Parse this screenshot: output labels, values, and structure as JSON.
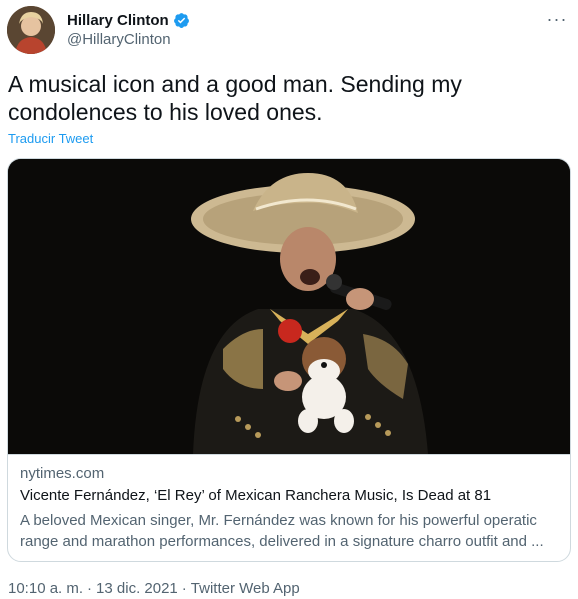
{
  "author": {
    "name": "Hillary Clinton",
    "handle": "@HillaryClinton",
    "verified_icon": "verified-badge-icon",
    "avatar_icon": "profile-avatar"
  },
  "more_icon": "more-options-icon",
  "more_glyph": "···",
  "tweet": {
    "text": "A musical icon and a good man. Sending my condolences to his loved ones.",
    "translate_label": "Traducir Tweet"
  },
  "card": {
    "domain": "nytimes.com",
    "title": "Vicente Fernández, ‘El Rey’ of Mexican Ranchera Music, Is Dead at 81",
    "description": "A beloved Mexican singer, Mr. Fernández was known for his powerful operatic range and marathon performances, delivered in a signature charro outfit and ..."
  },
  "meta": {
    "time": "10:10 a. m.",
    "separator1": "·",
    "date": "13 dic. 2021",
    "separator2": "·",
    "app": "Twitter Web App"
  },
  "colors": {
    "accent": "#1d9bf0",
    "text": "#0f1419",
    "secondary": "#536471",
    "border": "#cfd9de"
  }
}
